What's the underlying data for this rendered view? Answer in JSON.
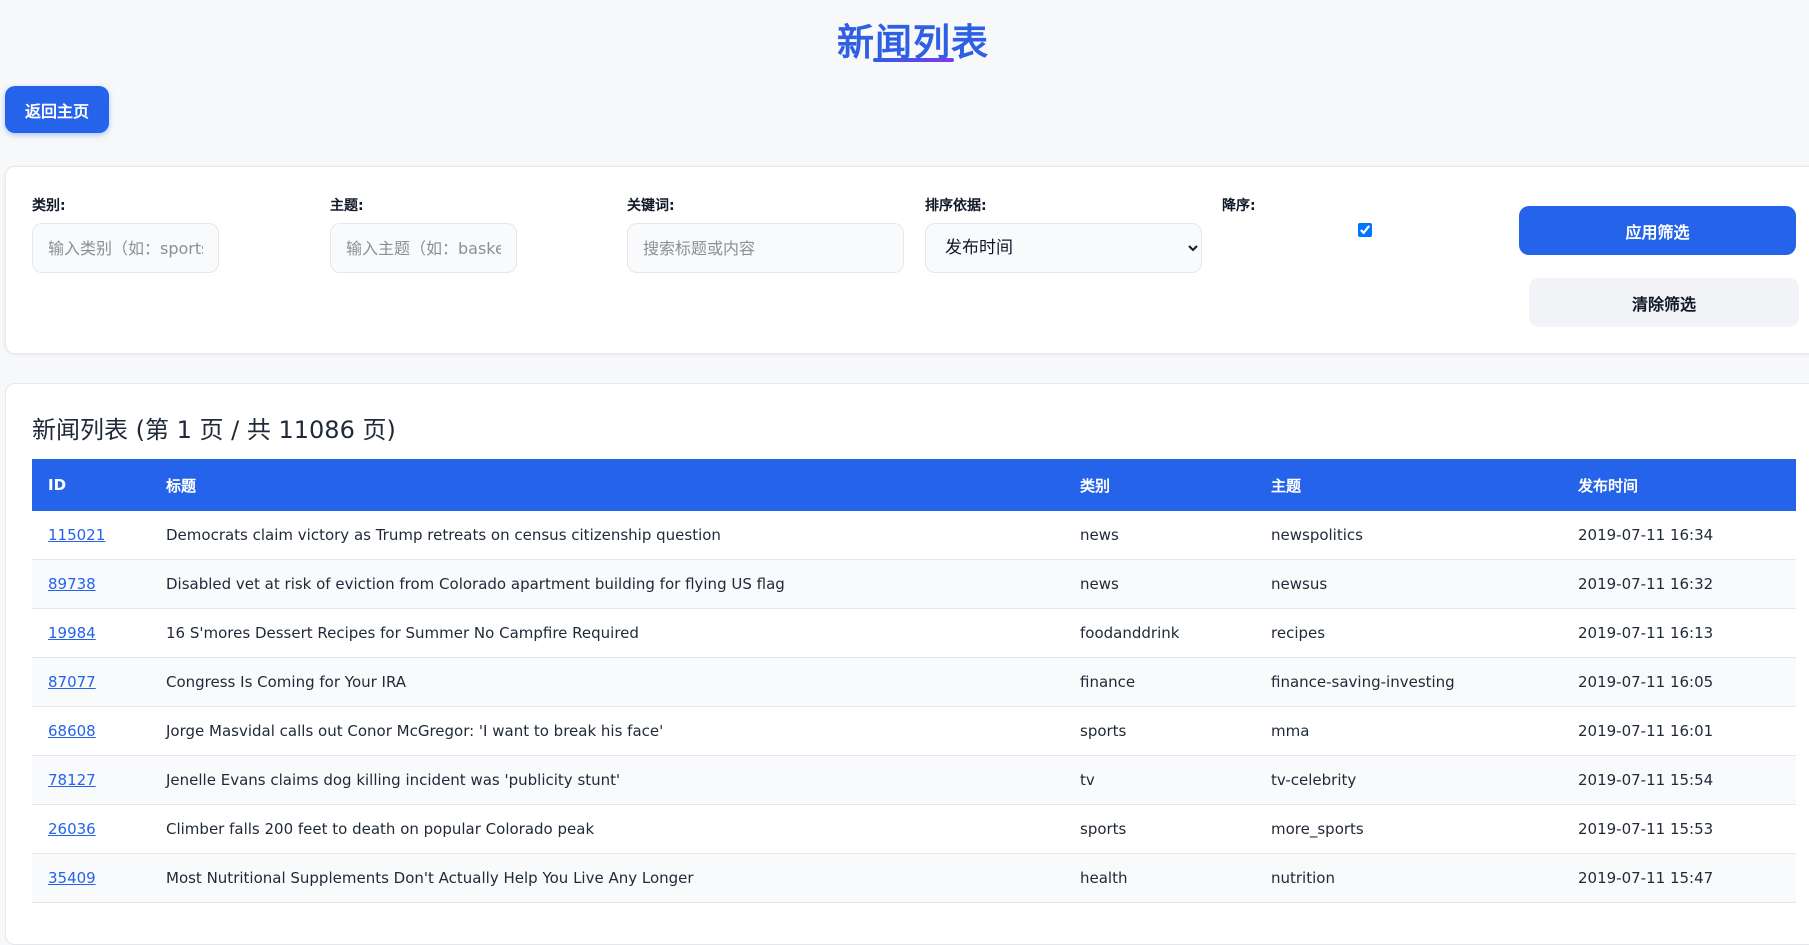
{
  "page": {
    "title": "新闻列表"
  },
  "nav": {
    "home_label": "返回主页"
  },
  "filters": {
    "category": {
      "label": "类别:",
      "placeholder": "输入类别（如：sports）",
      "value": ""
    },
    "topic": {
      "label": "主题:",
      "placeholder": "输入主题（如：basketball）",
      "value": ""
    },
    "keyword": {
      "label": "关键词:",
      "placeholder": "搜索标题或内容",
      "value": ""
    },
    "sort": {
      "label": "排序依据:",
      "selected": "发布时间"
    },
    "descending": {
      "label": "降序:",
      "checked": true
    },
    "apply_label": "应用筛选",
    "clear_label": "清除筛选"
  },
  "list": {
    "heading": "新闻列表 (第 1 页 / 共 11086 页)",
    "columns": [
      "ID",
      "标题",
      "类别",
      "主题",
      "发布时间"
    ],
    "rows": [
      {
        "id": "115021",
        "title": "Democrats claim victory as Trump retreats on census citizenship question",
        "category": "news",
        "topic": "newspolitics",
        "time": "2019-07-11 16:34"
      },
      {
        "id": "89738",
        "title": "Disabled vet at risk of eviction from Colorado apartment building for flying US flag",
        "category": "news",
        "topic": "newsus",
        "time": "2019-07-11 16:32"
      },
      {
        "id": "19984",
        "title": "16 S'mores Dessert Recipes for Summer No Campfire Required",
        "category": "foodanddrink",
        "topic": "recipes",
        "time": "2019-07-11 16:13"
      },
      {
        "id": "87077",
        "title": "Congress Is Coming for Your IRA",
        "category": "finance",
        "topic": "finance-saving-investing",
        "time": "2019-07-11 16:05"
      },
      {
        "id": "68608",
        "title": "Jorge Masvidal calls out Conor McGregor: 'I want to break his face'",
        "category": "sports",
        "topic": "mma",
        "time": "2019-07-11 16:01"
      },
      {
        "id": "78127",
        "title": "Jenelle Evans claims dog killing incident was 'publicity stunt'",
        "category": "tv",
        "topic": "tv-celebrity",
        "time": "2019-07-11 15:54"
      },
      {
        "id": "26036",
        "title": "Climber falls 200 feet to death on popular Colorado peak",
        "category": "sports",
        "topic": "more_sports",
        "time": "2019-07-11 15:53"
      },
      {
        "id": "35409",
        "title": "Most Nutritional Supplements Don't Actually Help You Live Any Longer",
        "category": "health",
        "topic": "nutrition",
        "time": "2019-07-11 15:47"
      }
    ]
  }
}
